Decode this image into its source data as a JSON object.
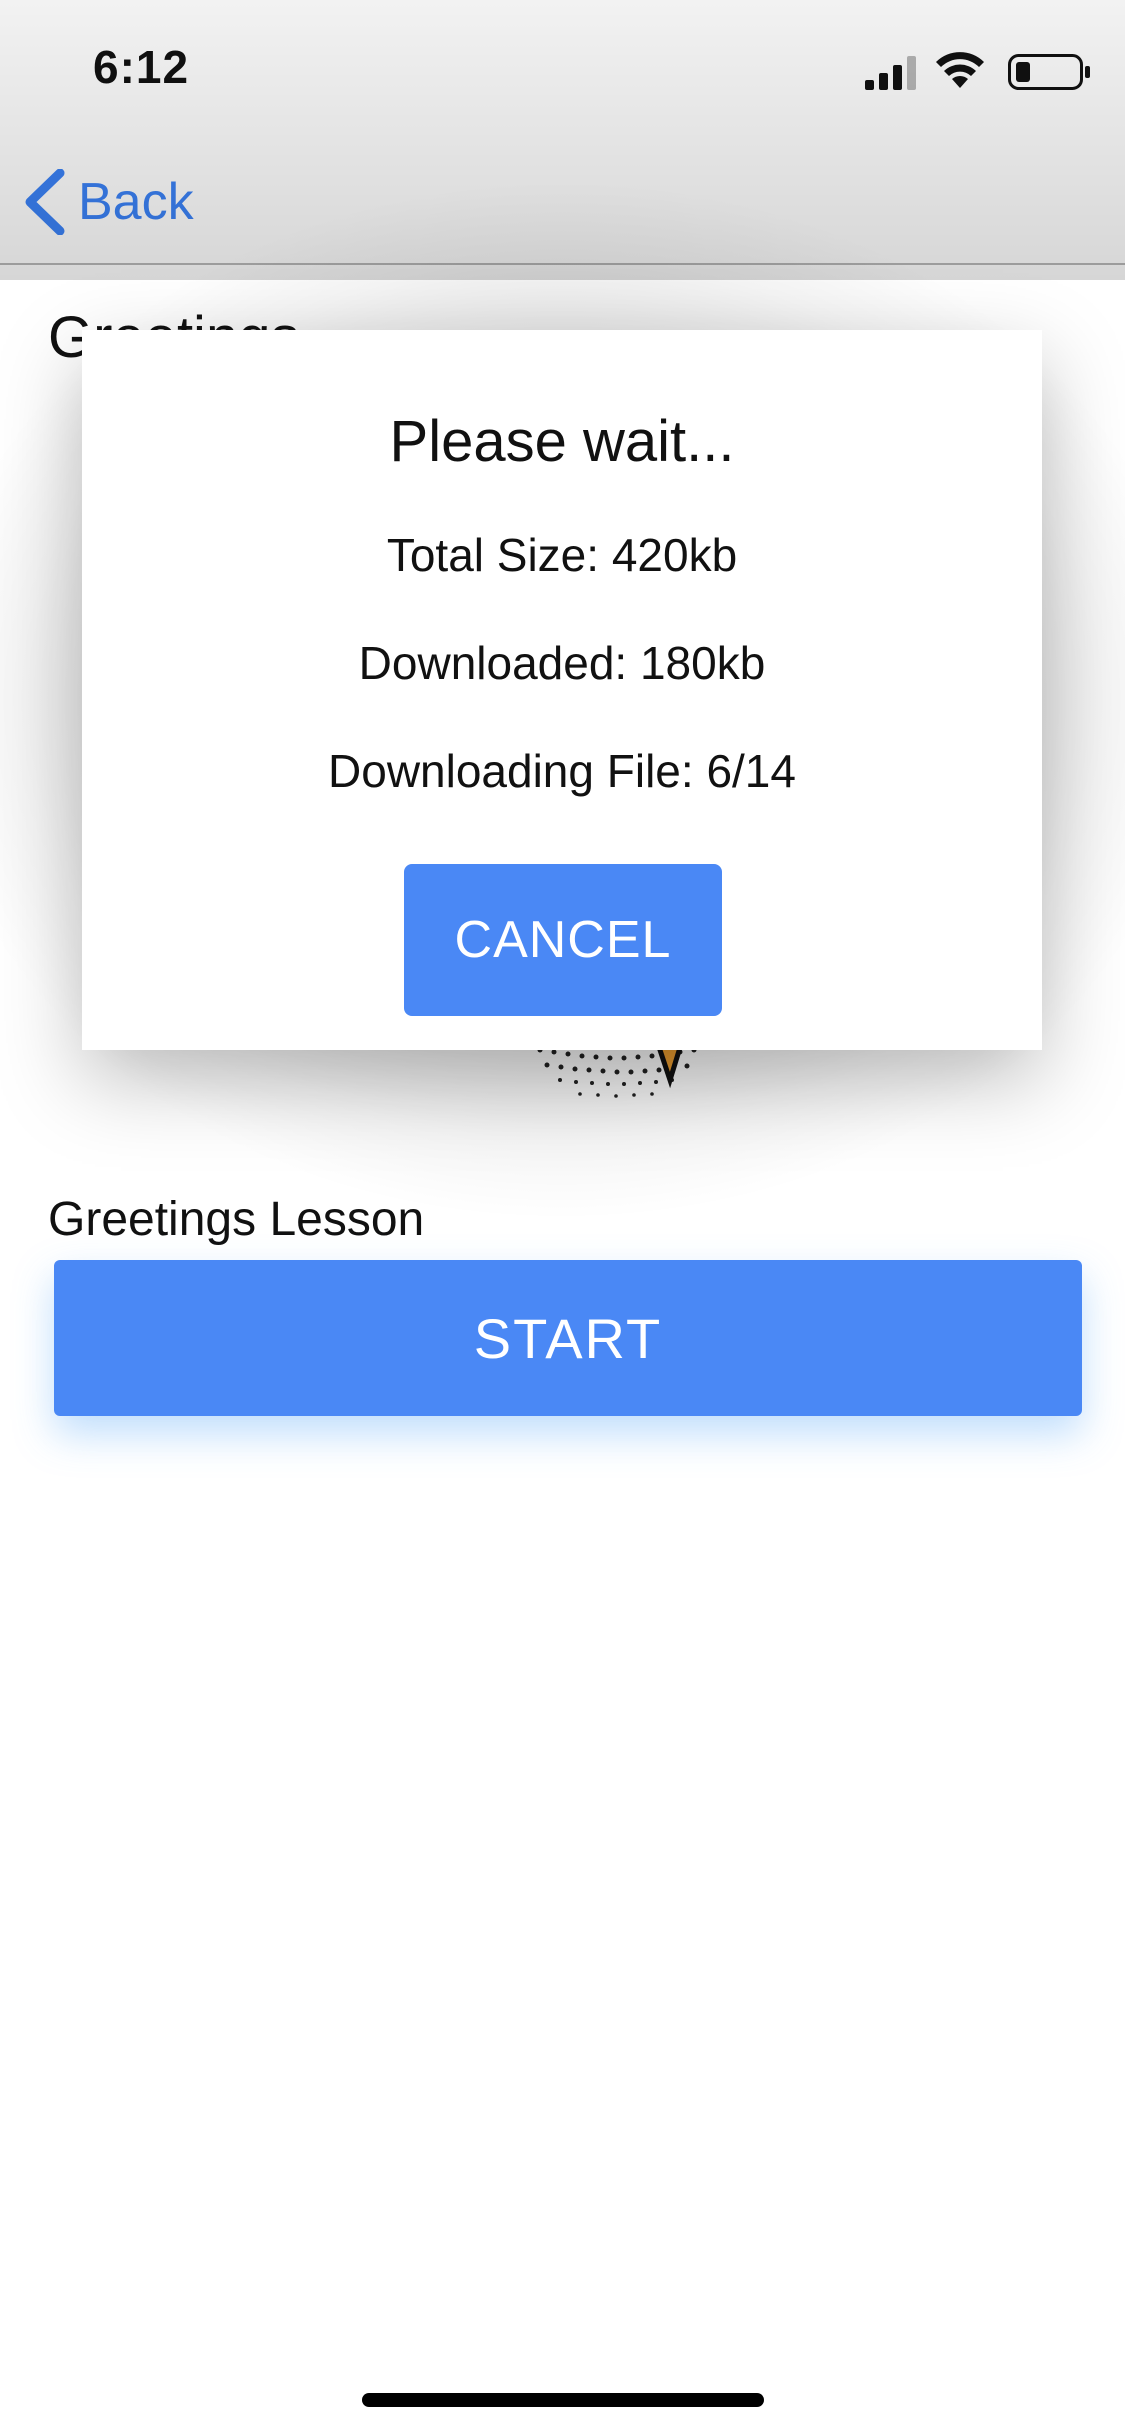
{
  "status_bar": {
    "time": "6:12"
  },
  "nav": {
    "back_label": "Back"
  },
  "content": {
    "section_title": "Greetings",
    "lesson_label": "Greetings Lesson",
    "start_label": "START"
  },
  "dialog": {
    "title": "Please wait...",
    "total_size": "Total Size: 420kb",
    "downloaded": "Downloaded: 180kb",
    "downloading_file": "Downloading File: 6/14",
    "cancel_label": "CANCEL"
  },
  "colors": {
    "accent": "#4a88f5",
    "link": "#3b82f6"
  },
  "icons": [
    "signal-icon",
    "wifi-icon",
    "battery-icon",
    "back-chevron-icon"
  ]
}
